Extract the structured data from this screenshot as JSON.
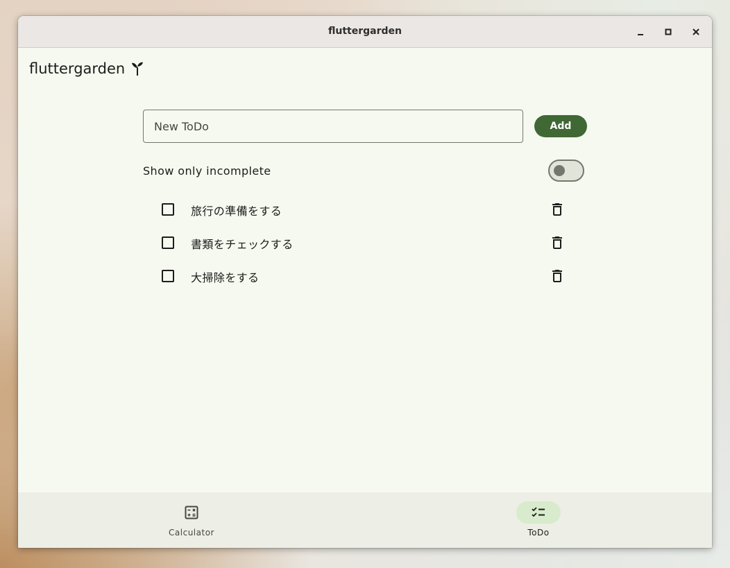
{
  "window": {
    "title": "fluttergarden"
  },
  "app": {
    "title": "fluttergarden",
    "title_icon": "sprout-icon"
  },
  "input": {
    "placeholder": "New ToDo",
    "value": ""
  },
  "add_button": {
    "label": "Add"
  },
  "filter": {
    "label": "Show only incomplete",
    "enabled": false
  },
  "todos": [
    {
      "text": "旅行の準備をする",
      "done": false
    },
    {
      "text": "書類をチェックする",
      "done": false
    },
    {
      "text": "大掃除をする",
      "done": false
    }
  ],
  "nav": {
    "items": [
      {
        "label": "Calculator",
        "icon": "calculator-icon",
        "selected": false
      },
      {
        "label": "ToDo",
        "icon": "checklist-icon",
        "selected": true
      }
    ]
  },
  "colors": {
    "primary": "#3f6834",
    "background": "#f6f9f0",
    "nav_background": "#edeee6",
    "nav_indicator": "#d8ebcc",
    "outline": "#74776f"
  }
}
